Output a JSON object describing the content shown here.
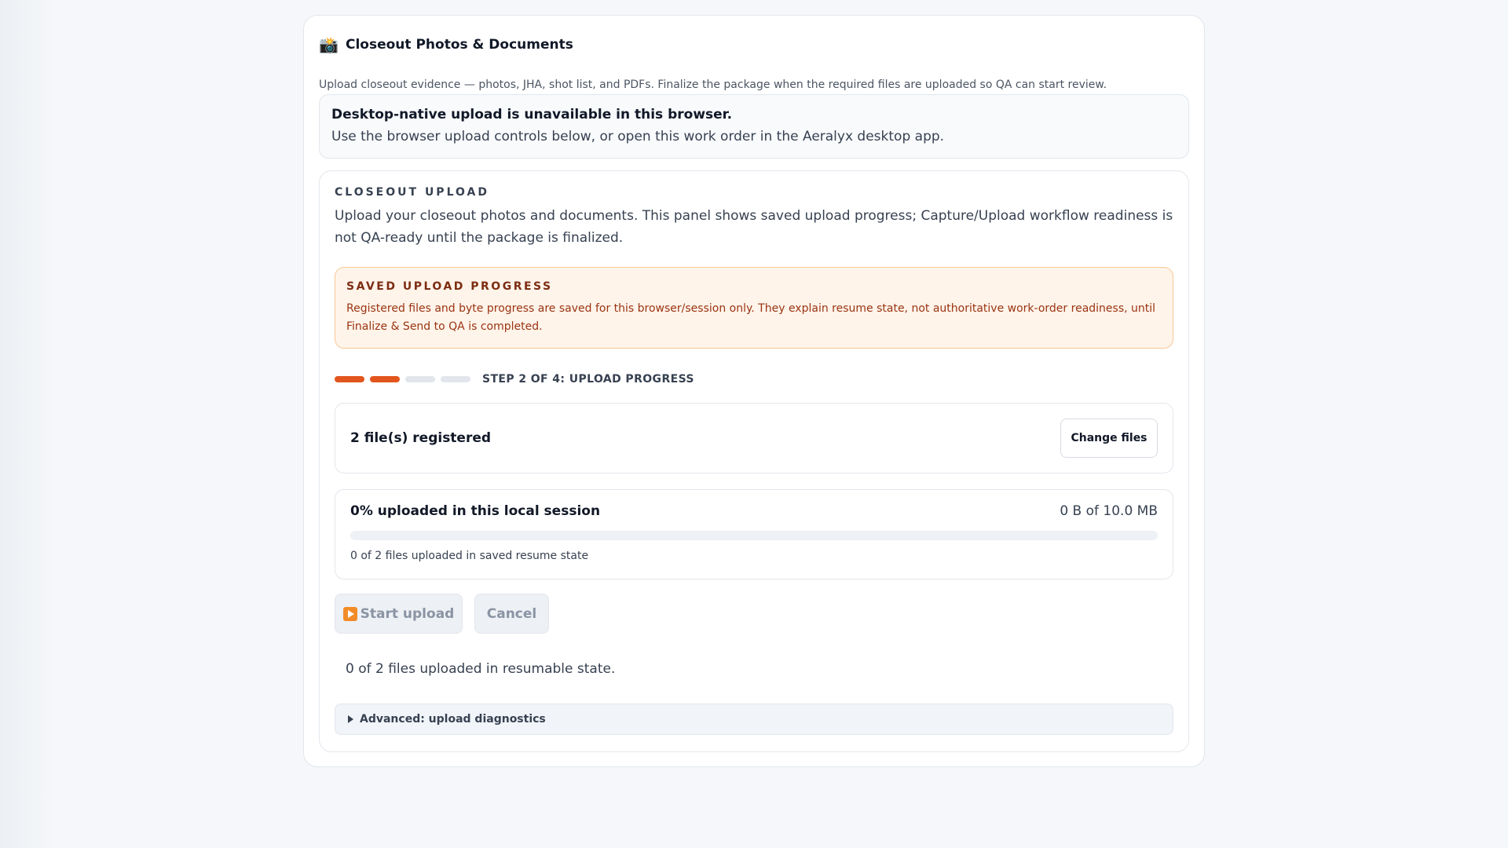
{
  "card": {
    "icon": "camera-icon",
    "title": "Closeout Photos & Documents",
    "subtitle": "Upload closeout evidence — photos, JHA, shot list, and PDFs. Finalize the package when the required files are uploaded so QA can start review."
  },
  "notice": {
    "title": "Desktop-native upload is unavailable in this browser.",
    "body": "Use the browser upload controls below, or open this work order in the Aeralyx desktop app."
  },
  "panel": {
    "eyebrow": "CLOSEOUT UPLOAD",
    "description": "Upload your closeout photos and documents. This panel shows saved upload progress; Capture/Upload workflow readiness is not QA-ready until the package is finalized.",
    "saved": {
      "title": "SAVED UPLOAD PROGRESS",
      "body": "Registered files and byte progress are saved for this browser/session only. They explain resume state, not authoritative work-order readiness, until Finalize & Send to QA is completed."
    },
    "steps": {
      "current": 2,
      "total": 4,
      "label": "STEP 2 OF 4: UPLOAD PROGRESS"
    },
    "files": {
      "label": "2 file(s) registered",
      "change_button": "Change files"
    },
    "progress": {
      "label": "0% uploaded in this local session",
      "bytes": "0 B of 10.0 MB",
      "percent": 0,
      "note": "0 of 2 files uploaded in saved resume state"
    },
    "actions": {
      "start_label": "Start upload",
      "start_icon": "play-icon",
      "cancel_label": "Cancel"
    },
    "resume_status": "0 of 2 files uploaded in resumable state.",
    "diagnostics_label": "Advanced: upload diagnostics"
  },
  "colors": {
    "accent": "#e2551d",
    "warning_bg": "#fff4ea",
    "warning_text": "#9a3412"
  }
}
